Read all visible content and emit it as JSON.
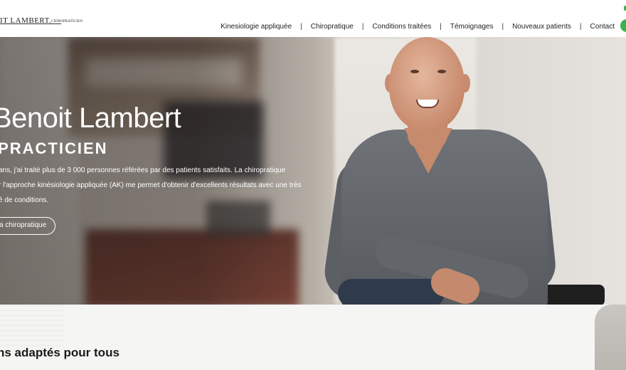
{
  "header": {
    "logo_name": "IT LAMBERT.",
    "logo_suffix": "CHIROPRATICIEN"
  },
  "nav": {
    "items": [
      "Kinesiologie appliquée",
      "Chiropratique",
      "Conditions traitées",
      "Témoignages",
      "Nouveaux patients",
      "Contact"
    ],
    "separator": "|"
  },
  "hero": {
    "name": "Benoit Lambert",
    "role": "OPRACTICIEN",
    "lines": [
      "ans, j'ai traité plus de 3 000 personnes référées par des patients satisfaits. La chiropratique",
      "r l'approche kinésiologie appliquée (AK) me permet d'obtenir d'excellents résultats avec une très",
      "é de conditions."
    ],
    "button_label": "a chiropratique"
  },
  "section": {
    "title": "ns adaptés pour tous"
  },
  "colors": {
    "accent_green": "#3bb54a",
    "text_dark": "#1f1f1f",
    "hero_text": "#ffffff"
  }
}
